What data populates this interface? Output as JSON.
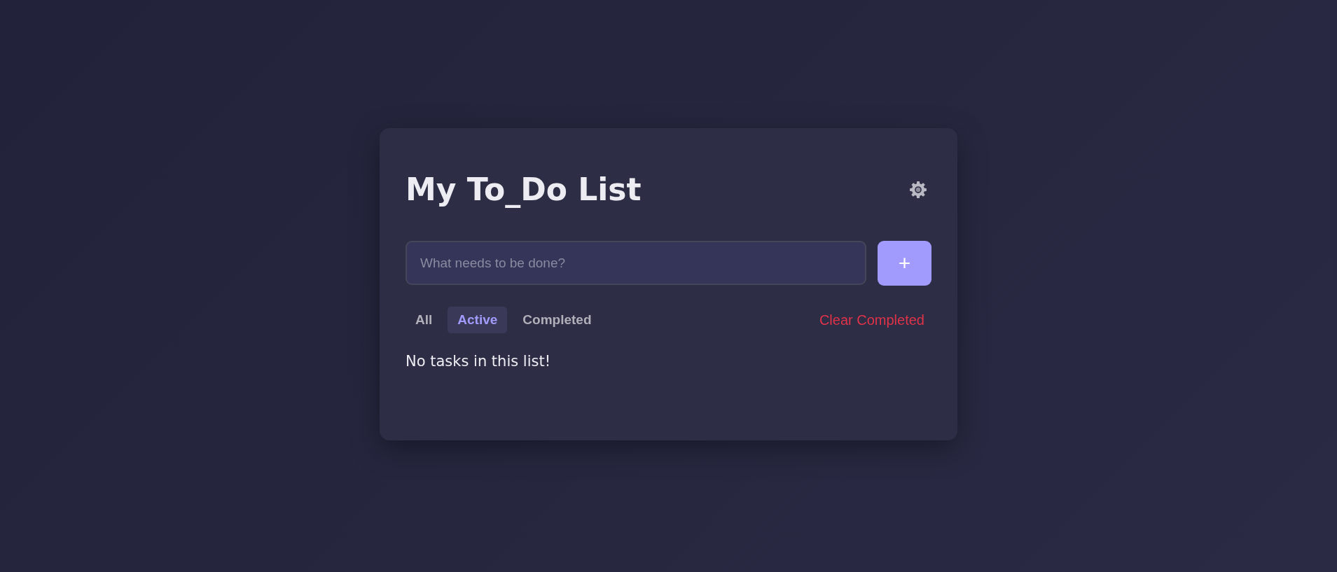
{
  "title": "My To_Do List",
  "new_task": {
    "placeholder": "What needs to be done?",
    "add_button": "+"
  },
  "filters": [
    {
      "label": "All",
      "selected": false
    },
    {
      "label": "Active",
      "selected": true
    },
    {
      "label": "Completed",
      "selected": false
    }
  ],
  "clear_button": "Clear Completed",
  "empty_message": "No tasks in this list!"
}
